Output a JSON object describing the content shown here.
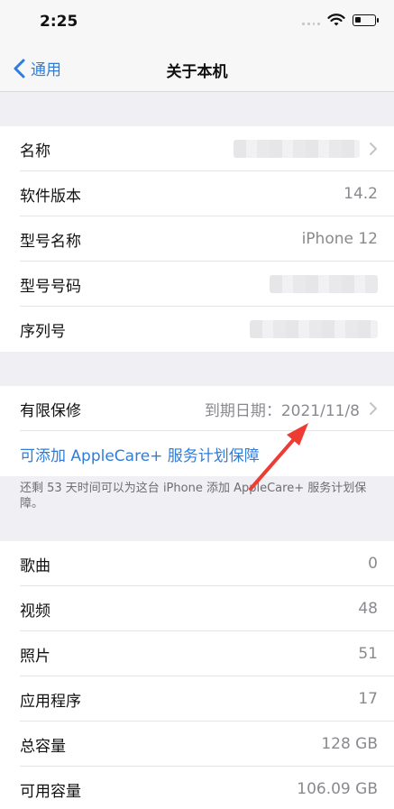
{
  "status_bar": {
    "time": "2:25"
  },
  "nav": {
    "back_label": "通用",
    "title": "关于本机"
  },
  "info": [
    {
      "label": "名称",
      "value": ""
    },
    {
      "label": "软件版本",
      "value": "14.2"
    },
    {
      "label": "型号名称",
      "value": "iPhone 12"
    },
    {
      "label": "型号号码",
      "value": ""
    },
    {
      "label": "序列号",
      "value": ""
    }
  ],
  "warranty": {
    "label": "有限保修",
    "value": "到期日期：2021/11/8",
    "link": "可添加 AppleCare+ 服务计划保障",
    "footnote": "还剩 53 天时间可以为这台 iPhone 添加 AppleCare+ 服务计划保障。"
  },
  "stats": [
    {
      "label": "歌曲",
      "value": "0"
    },
    {
      "label": "视频",
      "value": "48"
    },
    {
      "label": "照片",
      "value": "51"
    },
    {
      "label": "应用程序",
      "value": "17"
    },
    {
      "label": "总容量",
      "value": "128 GB"
    },
    {
      "label": "可用容量",
      "value": "106.09 GB"
    }
  ],
  "colors": {
    "accent": "#2f7ddb",
    "annotation_arrow": "#ee3b34"
  },
  "icons": [
    "back-chevron-icon",
    "chevron-right-icon",
    "wifi-icon",
    "battery-icon",
    "signal-icon"
  ]
}
